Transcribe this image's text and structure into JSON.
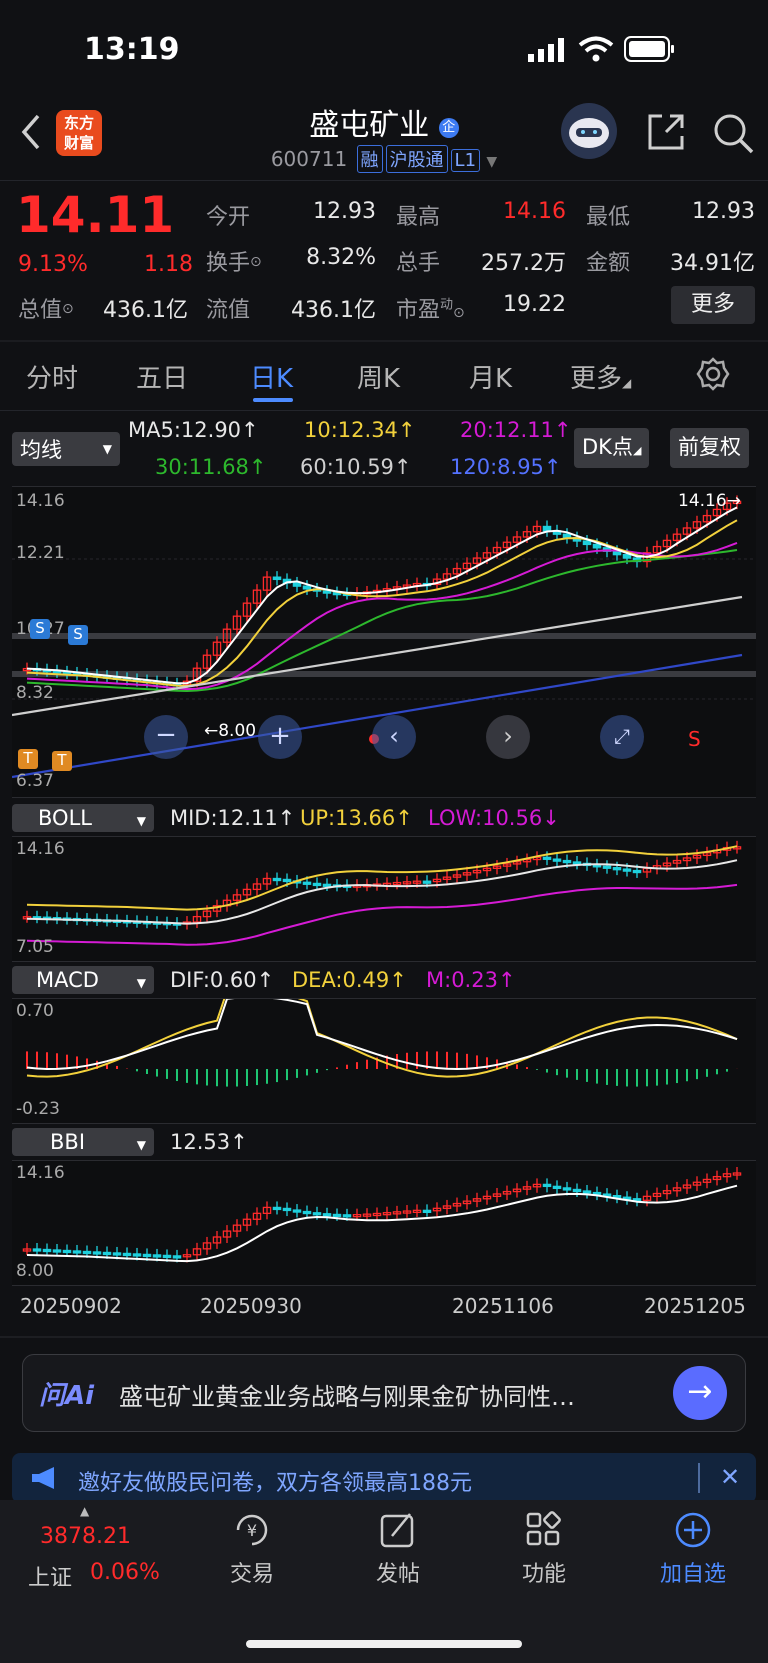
{
  "status": {
    "time": "13:19"
  },
  "header": {
    "logo_text": "东方财富",
    "stock_name": "盛屯矿业",
    "stock_code": "600711",
    "tags": [
      "融",
      "沪股通",
      "L1"
    ]
  },
  "quote": {
    "price": "14.11",
    "change_pct": "9.13%",
    "change": "1.18",
    "fields": [
      {
        "label": "今开",
        "value": "12.93",
        "color": "white"
      },
      {
        "label": "最高",
        "value": "14.16",
        "color": "red"
      },
      {
        "label": "最低",
        "value": "12.93",
        "color": "white"
      },
      {
        "label": "换手",
        "value": "8.32%",
        "color": "white"
      },
      {
        "label": "总手",
        "value": "257.2万",
        "color": "white"
      },
      {
        "label": "金额",
        "value": "34.91亿",
        "color": "white"
      },
      {
        "label": "总值",
        "value": "436.1亿",
        "color": "white"
      },
      {
        "label": "流值",
        "value": "436.1亿",
        "color": "white"
      },
      {
        "label": "市盈",
        "value": "19.22",
        "color": "white"
      }
    ],
    "pe_superscript": "动",
    "more_button": "更多"
  },
  "tabs": [
    "分时",
    "五日",
    "日K",
    "周K",
    "月K",
    "更多"
  ],
  "active_tab": "日K",
  "ma": {
    "selector": "均线",
    "ma5": "MA5:12.90↑",
    "ma10": "10:12.34↑",
    "ma20": "20:12.11↑",
    "ma30": "30:11.68↑",
    "ma60": "60:10.59↑",
    "ma120": "120:8.95↑",
    "dk_button": "DK点",
    "fq_button": "前复权"
  },
  "main_chart": {
    "axis_top": "14.16",
    "axis_2": "12.21",
    "axis_3": "10.27",
    "axis_4": "8.32",
    "axis_bottom": "6.37",
    "high_marker": "14.16→",
    "low_marker": "←8.00",
    "s_markers": [
      "S",
      "S"
    ],
    "t_markers": [
      "T",
      "T"
    ],
    "s_label": "S"
  },
  "boll": {
    "selector": "BOLL",
    "mid": "MID:12.11↑",
    "up": "UP:13.66↑",
    "low": "LOW:10.56↓",
    "axis_top": "14.16",
    "axis_bottom": "7.05"
  },
  "macd": {
    "selector": "MACD",
    "dif": "DIF:0.60↑",
    "dea": "DEA:0.49↑",
    "m": "M:0.23↑",
    "axis_top": "0.70",
    "axis_bottom": "-0.23"
  },
  "bbi": {
    "selector": "BBI",
    "value": "12.53↑",
    "axis_top": "14.16",
    "axis_bottom": "8.00"
  },
  "dates": [
    "20250902",
    "20250930",
    "20251106",
    "20251205"
  ],
  "ask": {
    "logo": "问Ai",
    "text": "盛屯矿业黄金业务战略与刚果金矿协同性…"
  },
  "banner": {
    "text": "邀好友做股民问卷，双方各领最高188元"
  },
  "tabbar": {
    "index_value": "3878.21",
    "index_name": "上证",
    "index_change": "0.06%",
    "items": [
      "交易",
      "发帖",
      "功能",
      "加自选"
    ]
  },
  "colors": {
    "up": "#ff2b2b",
    "down": "#1ec773",
    "accent": "#3d7bf2",
    "yellow": "#f2d13c",
    "magenta": "#d51bd5"
  }
}
